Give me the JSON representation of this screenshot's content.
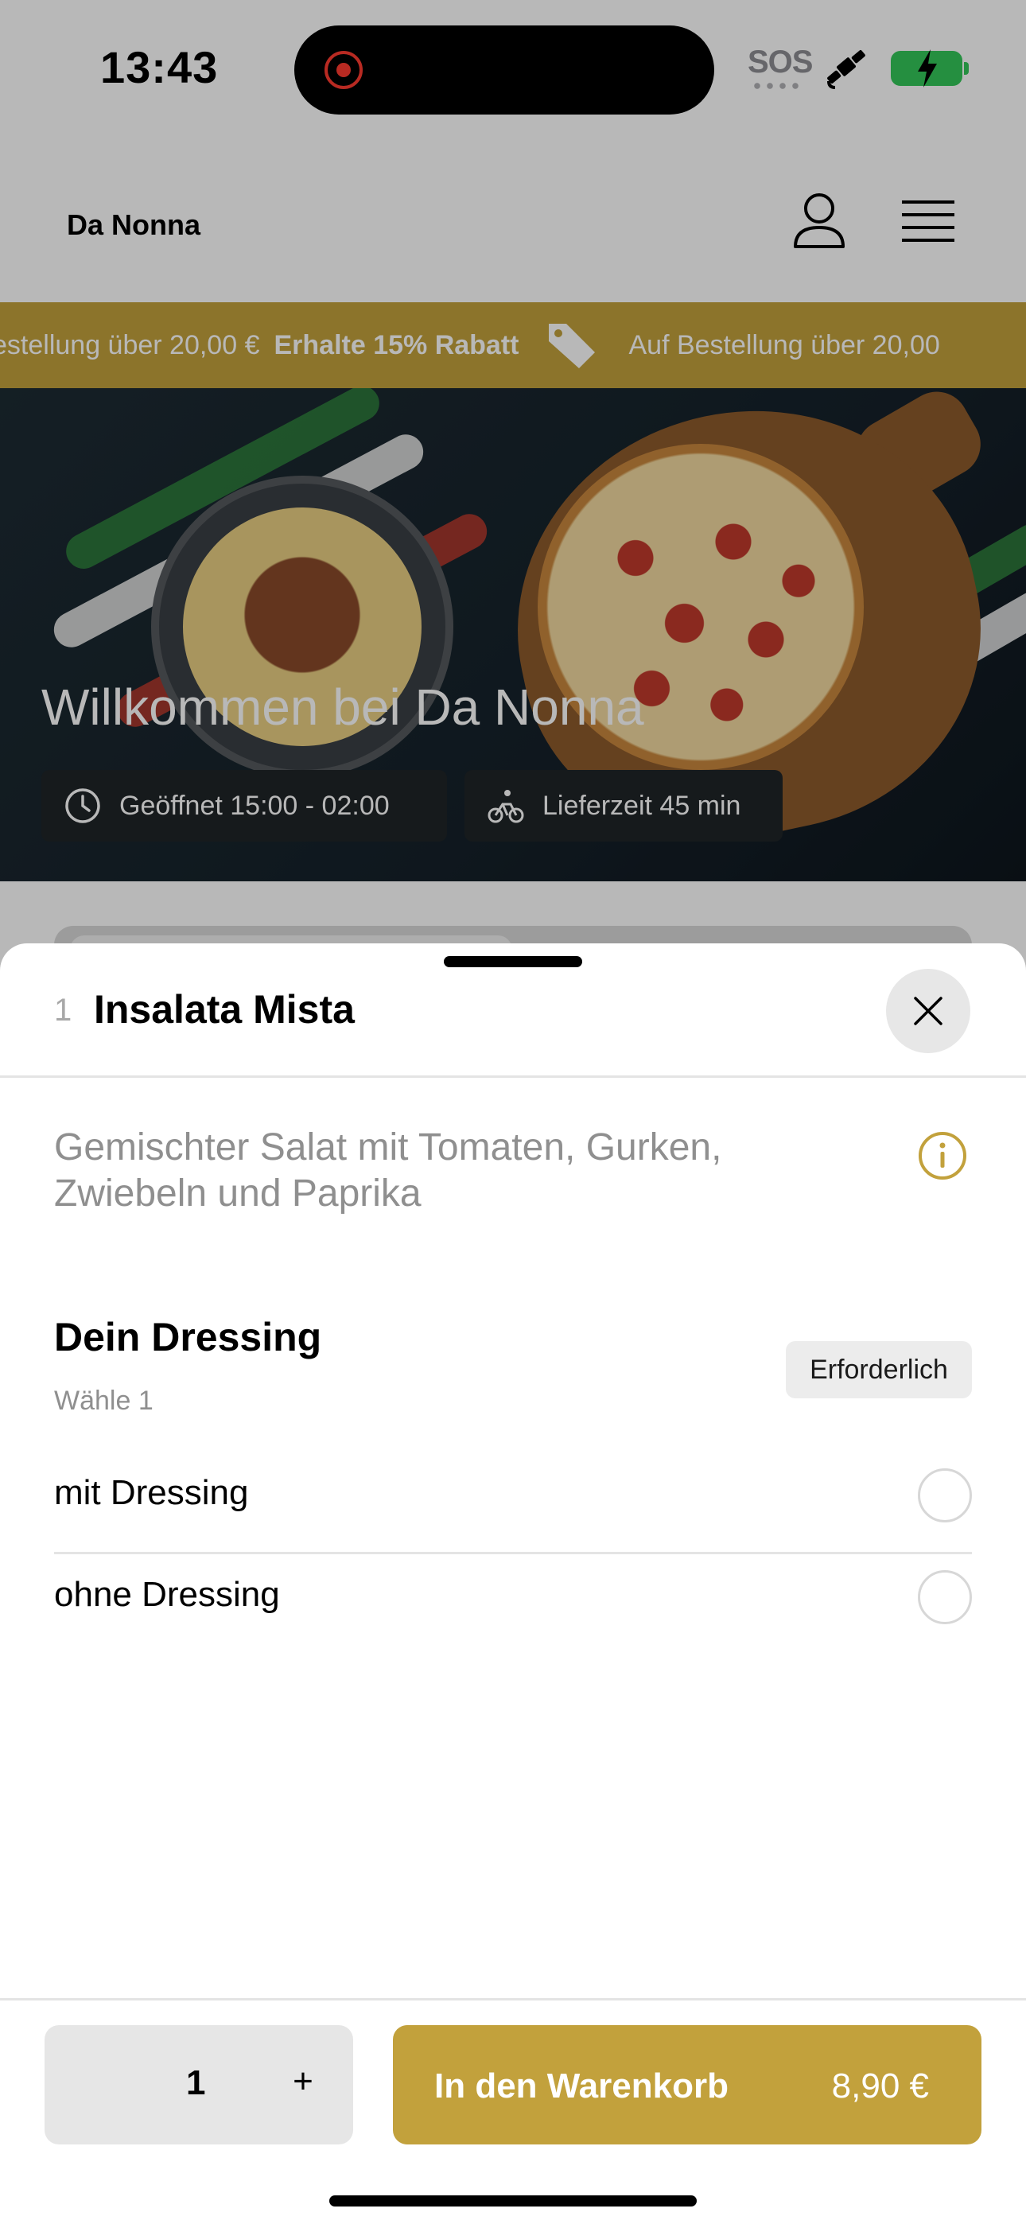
{
  "status_bar": {
    "time": "13:43",
    "sos": "SOS"
  },
  "header": {
    "brand": "Da Nonna"
  },
  "promo": {
    "text_left": "estellung über 20,00 €",
    "highlight": "Erhalte 15% Rabatt",
    "text_right": "Auf Bestellung über 20,00"
  },
  "hero": {
    "title": "Willkommen bei Da Nonna",
    "opening_hours": "Geöffnet 15:00 - 02:00",
    "delivery_time": "Lieferzeit 45 min"
  },
  "sheet": {
    "item_quantity": "1",
    "item_name": "Insalata Mista",
    "description": "Gemischter Salat mit Tomaten, Gurken, Zwiebeln und Paprika",
    "section": {
      "title": "Dein Dressing",
      "subtitle": "Wähle 1",
      "badge": "Erforderlich",
      "options": [
        {
          "label": "mit Dressing",
          "selected": false
        },
        {
          "label": "ohne Dressing",
          "selected": false
        }
      ]
    },
    "footer": {
      "quantity": "1",
      "plus": "+",
      "add_to_cart": "In den Warenkorb",
      "price": "8,90 €"
    }
  },
  "colors": {
    "accent": "#c2a13c",
    "battery": "#34c759",
    "recording": "#ff3b30"
  }
}
